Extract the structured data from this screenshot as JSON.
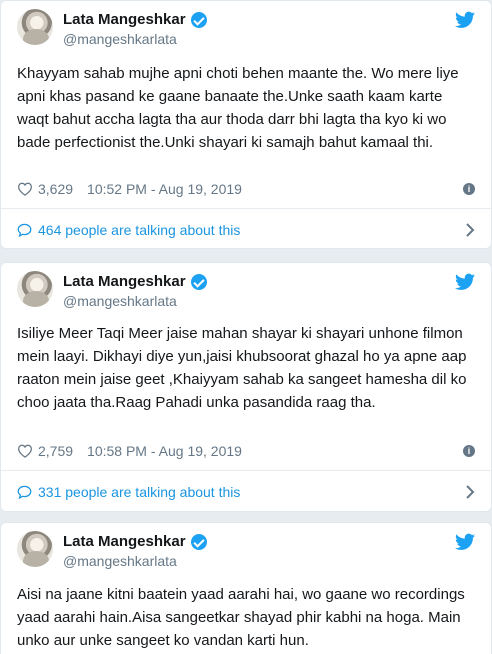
{
  "tweets": [
    {
      "author": "Lata Mangeshkar",
      "handle": "@mangeshkarlata",
      "text": "Khayyam sahab mujhe apni choti behen maante the. Wo mere liye apni khas pasand ke gaane banaate the.Unke saath kaam karte waqt bahut accha lagta tha aur thoda darr bhi lagta tha kyo ki wo bade perfectionist the.Unki shayari ki samajh bahut kamaal thi.",
      "likes": "3,629",
      "timestamp": "10:52 PM - Aug 19, 2019",
      "talking": "464 people are talking about this"
    },
    {
      "author": "Lata Mangeshkar",
      "handle": "@mangeshkarlata",
      "text": "Isiliye Meer Taqi Meer jaise mahan shayar ki shayari unhone filmon mein laayi. Dikhayi diye yun,jaisi khubsoorat ghazal ho ya apne aap raaton mein jaise geet ,Khaiyyam sahab ka sangeet hamesha dil ko choo jaata tha.Raag Pahadi unka pasandida raag tha.",
      "likes": "2,759",
      "timestamp": "10:58 PM - Aug 19, 2019",
      "talking": "331 people are talking about this"
    },
    {
      "author": "Lata Mangeshkar",
      "handle": "@mangeshkarlata",
      "text": "Aisi na jaane kitni baatein yaad aarahi hai, wo gaane wo recordings yaad aarahi hain.Aisa sangeetkar shayad phir kabhi na hoga. Main unko aur unke sangeet ko vandan karti hun."
    }
  ],
  "colors": {
    "twitter_blue": "#1da1f2",
    "link_blue": "#1b95e0",
    "muted_gray": "#657786",
    "background": "#e6ecf0"
  },
  "icons": {
    "brand": "twitter-bird-icon",
    "verified": "verified-badge-icon",
    "like": "heart-icon",
    "info": "info-icon",
    "reply": "speech-bubble-icon",
    "expand": "chevron-right-icon"
  }
}
